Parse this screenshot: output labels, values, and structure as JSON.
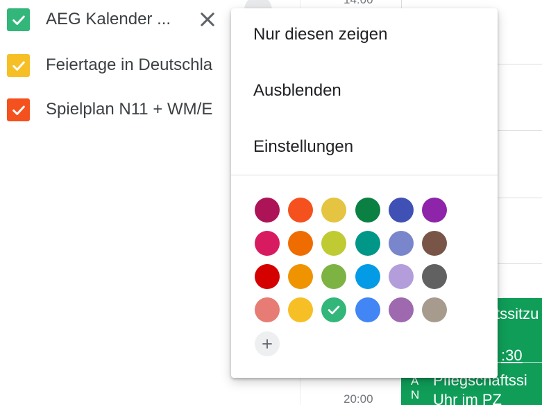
{
  "calendars": [
    {
      "label": "AEG Kalender ...",
      "color": "#33b679"
    },
    {
      "label": "Feiertage in Deutschla",
      "color": "#f6bf26"
    },
    {
      "label": "Spielplan N11 + WM/E",
      "color": "#f4511e"
    }
  ],
  "grid": {
    "times": [
      "14:00",
      "20:00"
    ],
    "events": [
      {
        "line1": "tssitzu",
        "line2": ":30"
      },
      {
        "marker": "A N",
        "line1": "Pflegschaftssi",
        "line2": "Uhr im PZ"
      }
    ],
    "event_color": "#0f9d58"
  },
  "menu": {
    "items": [
      "Nur diesen zeigen",
      "Ausblenden",
      "Einstellungen"
    ],
    "colors": [
      [
        "#ad1457",
        "#f4511e",
        "#e4c441",
        "#0b8043",
        "#3f51b5",
        "#8e24aa"
      ],
      [
        "#d81b60",
        "#ef6c00",
        "#c0ca33",
        "#009688",
        "#7986cb",
        "#795548"
      ],
      [
        "#d50000",
        "#f09300",
        "#7cb342",
        "#039be5",
        "#b39ddb",
        "#616161"
      ],
      [
        "#e67c73",
        "#f6bf26",
        "#33b679",
        "#4285f4",
        "#9e69af",
        "#a79b8e"
      ]
    ],
    "selected_color": "#33b679",
    "icons": {
      "close": "close-icon",
      "check": "check-icon",
      "add": "add-icon"
    }
  }
}
